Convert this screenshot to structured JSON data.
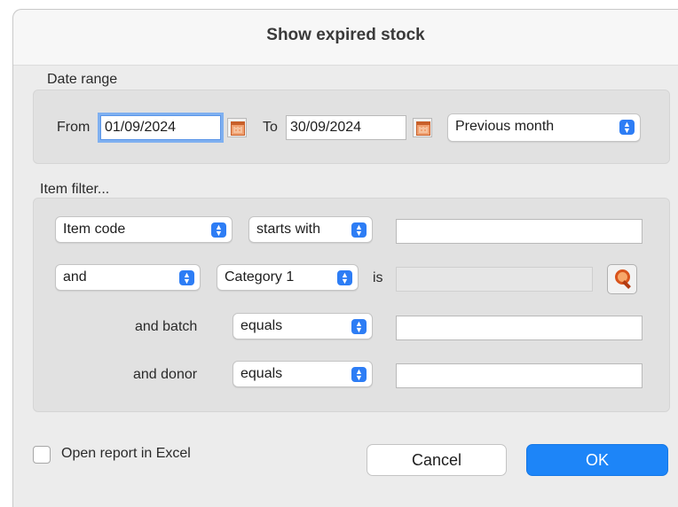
{
  "dialog": {
    "title": "Show expired stock"
  },
  "date_range": {
    "label": "Date range",
    "from_label": "From",
    "from_value": "01/09/2024",
    "to_label": "To",
    "to_value": "30/09/2024",
    "preset": "Previous month"
  },
  "item_filter": {
    "label": "Item filter...",
    "row1": {
      "field": "Item code",
      "operator": "starts with",
      "value": ""
    },
    "row2": {
      "conjunction": "and",
      "field": "Category 1",
      "is_label": "is",
      "value": ""
    },
    "batch": {
      "label": "and batch",
      "operator": "equals",
      "value": ""
    },
    "donor": {
      "label": "and donor",
      "operator": "equals",
      "value": ""
    }
  },
  "footer": {
    "excel_label": "Open report in Excel",
    "excel_checked": false,
    "cancel_label": "Cancel",
    "ok_label": "OK"
  },
  "colors": {
    "accent": "#1d85f8",
    "focus_ring": "#7fb0f0"
  }
}
